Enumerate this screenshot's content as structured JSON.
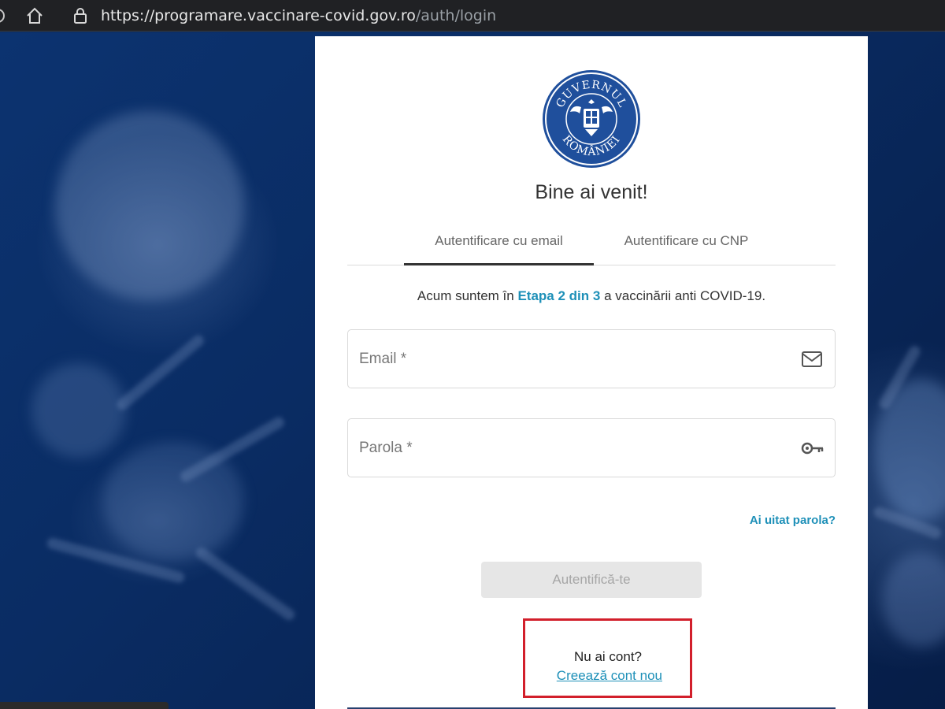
{
  "browser": {
    "url_host": "https://programare.vaccinare-covid.gov.ro",
    "url_path": "/auth/login"
  },
  "logo": {
    "top_text": "GUVERNUL",
    "bottom_text": "ROMÂNIEI"
  },
  "welcome": "Bine ai venit!",
  "tabs": [
    {
      "label": "Autentificare cu email",
      "active": true
    },
    {
      "label": "Autentificare cu CNP",
      "active": false
    }
  ],
  "stage": {
    "before": "Acum suntem în ",
    "highlight": "Etapa 2 din 3",
    "after": " a vaccinării anti COVID-19."
  },
  "form": {
    "email_placeholder": "Email *",
    "password_placeholder": "Parola *",
    "email_icon": "mail-icon",
    "password_icon": "key-icon",
    "forgot_label": "Ai uitat parola?",
    "submit_label": "Autentifică-te",
    "no_account_text": "Nu ai cont?",
    "create_account_label": "Creează cont nou"
  },
  "colors": {
    "accent": "#1e90b8",
    "highlight_border": "#d21f2b",
    "logo_blue": "#1f4f9c"
  }
}
